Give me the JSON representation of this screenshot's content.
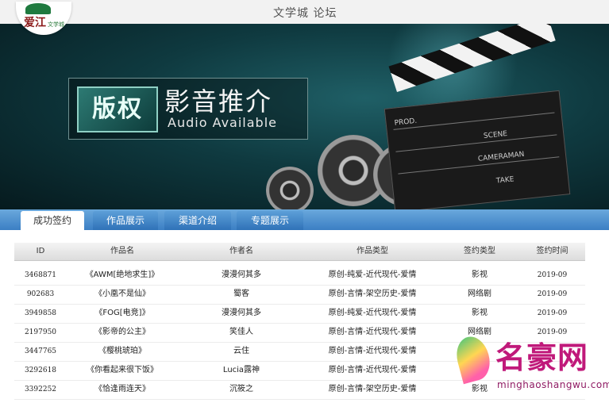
{
  "header": {
    "site_title": "文学城 论坛",
    "logo_text": "爱江",
    "logo_sub": "文学城"
  },
  "banner": {
    "tag": "版权",
    "title": "影音推介",
    "subtitle": "Audio Available",
    "clapper_labels": [
      "PROD.",
      "SCENE",
      "CAMERAMAN",
      "TAKE"
    ]
  },
  "tabs": [
    {
      "label": "成功签约",
      "active": true
    },
    {
      "label": "作品展示",
      "active": false
    },
    {
      "label": "渠道介绍",
      "active": false
    },
    {
      "label": "专题展示",
      "active": false
    }
  ],
  "table": {
    "columns": [
      "ID",
      "作品名",
      "作者名",
      "作品类型",
      "签约类型",
      "签约时间"
    ],
    "rows": [
      [
        "3468871",
        "《AWM[绝地求生]》",
        "漫漫何其多",
        "原创-纯爱-近代现代-爱情",
        "影视",
        "2019-09"
      ],
      [
        "902683",
        "《小凰不是仙》",
        "蜀客",
        "原创-言情-架空历史-爱情",
        "网络剧",
        "2019-09"
      ],
      [
        "3949858",
        "《FOG[电竞]》",
        "漫漫何其多",
        "原创-纯爱-近代现代-爱情",
        "影视",
        "2019-09"
      ],
      [
        "2197950",
        "《影帝的公主》",
        "笑佳人",
        "原创-言情-近代现代-爱情",
        "网络剧",
        "2019-09"
      ],
      [
        "3447765",
        "《樱桃琥珀》",
        "云住",
        "原创-言情-近代现代-爱情",
        "",
        ""
      ],
      [
        "3292618",
        "《你看起来很下饭》",
        "Lucia露神",
        "原创-言情-近代现代-爱情",
        "",
        ""
      ],
      [
        "3392252",
        "《恰逢雨连天》",
        "沉筱之",
        "原创-言情-架空历史-爱情",
        "影视",
        ""
      ]
    ]
  },
  "watermark": {
    "name": "名豪网",
    "url": "minghaoshangwu.com"
  }
}
